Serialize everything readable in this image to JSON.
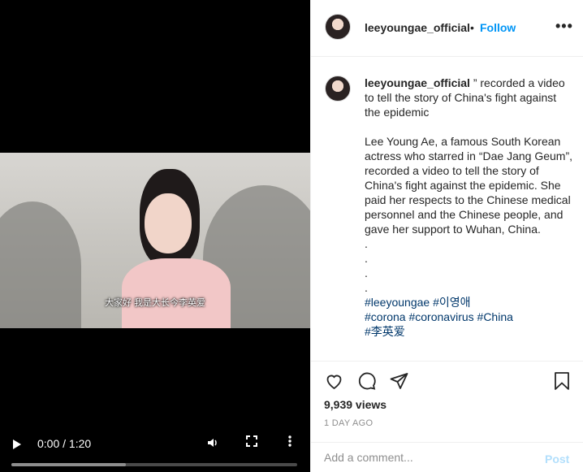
{
  "video": {
    "subtitle": "大家好 我是大长今李英爱",
    "time_display": "0:00 / 1:20",
    "buffered_fraction": 0.4,
    "icons": {
      "play": "play-icon",
      "volume": "volume-icon",
      "fullscreen": "fullscreen-icon",
      "more": "more-vertical-icon"
    }
  },
  "header": {
    "username": "leeyoungae_official",
    "separator": "•",
    "follow_label": "Follow",
    "more_label": "•••"
  },
  "caption": {
    "username": "leeyoungae_official",
    "title_text": " ” recorded a video to tell the story of China's fight against the epidemic",
    "body": "Lee Young Ae, a famous South Korean actress who starred in “Dae Jang Geum”, recorded a video to tell the story of China's fight against the epidemic. She paid her respects to the Chinese medical personnel and the Chinese people, and gave her support to Wuhan, China.",
    "dots": [
      ".",
      ".",
      ".",
      "."
    ],
    "hashtags": [
      "#leeyoungae",
      "#이영애",
      "#corona",
      "#coronavirus",
      "#China",
      "#李英爱"
    ]
  },
  "actions": {
    "views": "9,939 views",
    "time_ago": "1 DAY AGO",
    "icons": {
      "like": "heart-icon",
      "comment": "comment-icon",
      "share": "send-icon",
      "save": "bookmark-icon"
    }
  },
  "comment": {
    "placeholder": "Add a comment...",
    "post_label": "Post"
  },
  "colors": {
    "link": "#0095f6",
    "hashtag": "#00376b",
    "post_disabled": "#b2dffc",
    "muted": "#8e8e8e"
  }
}
